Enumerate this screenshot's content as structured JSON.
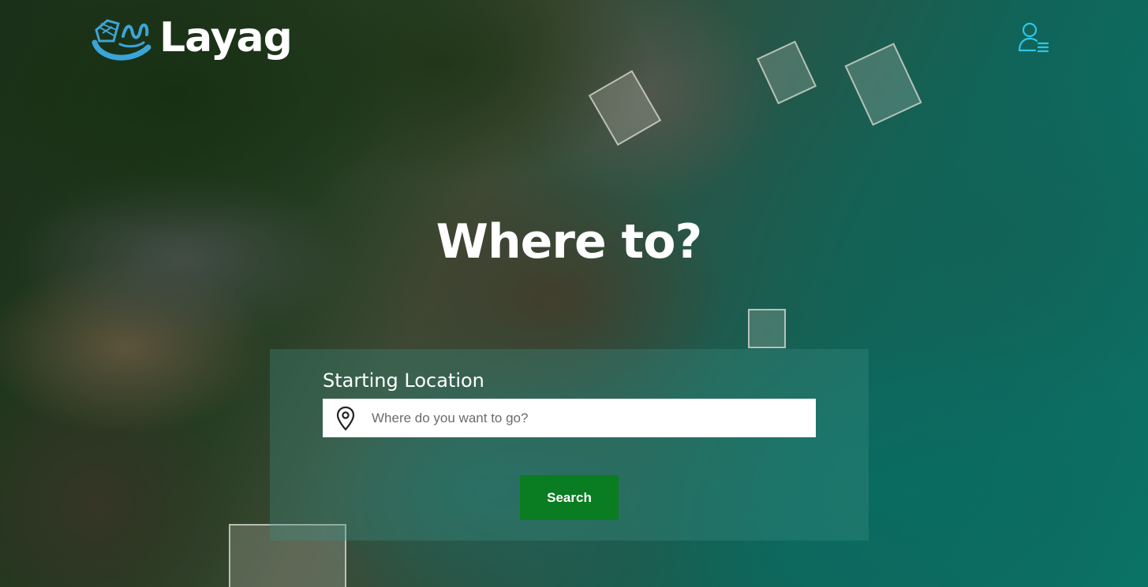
{
  "brand": {
    "name": "Layag",
    "mark_icon": "boat-wave-logo-icon",
    "accent_color": "#3aa5d8"
  },
  "header": {
    "user_menu_icon": "user-menu-icon",
    "user_menu_color": "#2ec6e8"
  },
  "hero": {
    "title": "Where to?"
  },
  "search": {
    "label": "Starting Location",
    "placeholder": "Where do you want to go?",
    "value": "",
    "location_icon": "map-pin-icon",
    "button_label": "Search",
    "button_color": "#0a7c21"
  }
}
